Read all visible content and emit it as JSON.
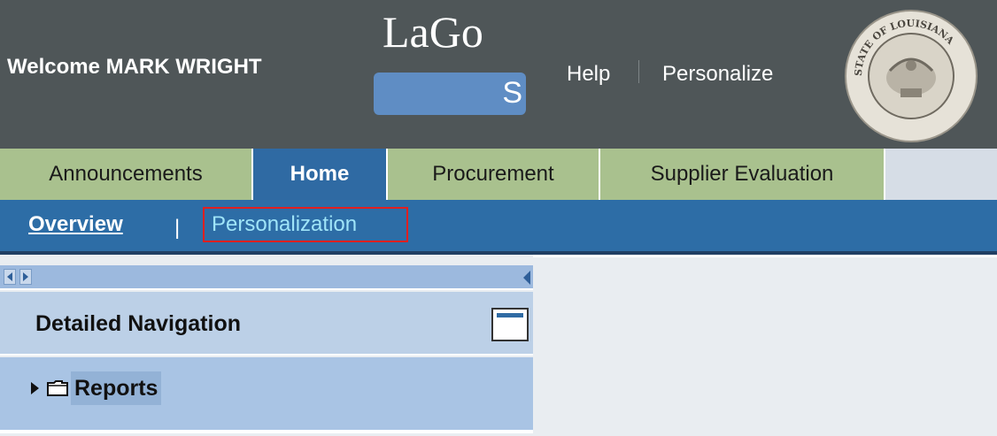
{
  "header": {
    "welcome": "Welcome MARK WRIGHT",
    "logo_text": "LaGo",
    "logo_bar_text": "S",
    "help": "Help",
    "personalize": "Personalize",
    "seal_text": "STATE OF LOUISIANA"
  },
  "tabs": [
    {
      "label": "Announcements",
      "active": false
    },
    {
      "label": "Home",
      "active": true
    },
    {
      "label": "Procurement",
      "active": false
    },
    {
      "label": "Supplier Evaluation",
      "active": false
    }
  ],
  "subnav": {
    "overview": "Overview",
    "separator": "|",
    "personalization": "Personalization"
  },
  "detailed_navigation": {
    "title": "Detailed Navigation",
    "items": [
      {
        "label": "Reports",
        "icon": "folder-icon"
      }
    ]
  },
  "colors": {
    "header_bg": "#4f5658",
    "tab_green": "#a9c18e",
    "tab_active": "#2f6aa3",
    "subnav_bg": "#2d6da6",
    "highlight_border": "#e02020"
  }
}
